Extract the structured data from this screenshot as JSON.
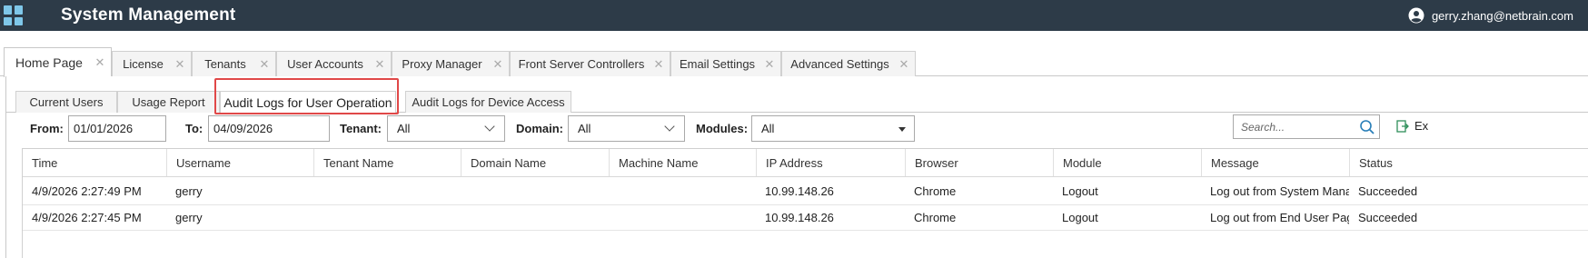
{
  "header": {
    "title": "System Management",
    "user": "gerry.zhang@netbrain.com",
    "colors": {
      "bar": "#2d3b48",
      "app_icon": "#7fc7e9"
    }
  },
  "top_tabs": [
    {
      "label": "Home Page",
      "active": true
    },
    {
      "label": "License"
    },
    {
      "label": "Tenants"
    },
    {
      "label": "User Accounts"
    },
    {
      "label": "Proxy Manager"
    },
    {
      "label": "Front Server Controllers"
    },
    {
      "label": "Email Settings"
    },
    {
      "label": "Advanced Settings"
    }
  ],
  "sub_tabs": [
    {
      "label": "Current Users"
    },
    {
      "label": "Usage Report"
    },
    {
      "label": "Audit Logs for User Operation",
      "active": true
    },
    {
      "label": "Audit Logs for Device Access"
    }
  ],
  "filters": {
    "from_label": "From:",
    "from_value": "01/01/2026",
    "to_label": "To:",
    "to_value": "04/09/2026",
    "tenant_label": "Tenant:",
    "tenant_value": "All",
    "domain_label": "Domain:",
    "domain_value": "All",
    "modules_label": "Modules:",
    "modules_value": "All",
    "search_placeholder": "Search...",
    "export_label": "Ex"
  },
  "table": {
    "columns": [
      "Time",
      "Username",
      "Tenant Name",
      "Domain Name",
      "Machine Name",
      "IP Address",
      "Browser",
      "Module",
      "Message",
      "Status"
    ],
    "rows": [
      [
        "4/9/2026 2:27:49 PM",
        "gerry",
        "",
        "",
        "",
        "10.99.148.26",
        "Chrome",
        "Logout",
        "Log out from System Manag...",
        "Succeeded"
      ],
      [
        "4/9/2026 2:27:45 PM",
        "gerry",
        "",
        "",
        "",
        "10.99.148.26",
        "Chrome",
        "Logout",
        "Log out from End User Page ...",
        "Succeeded"
      ]
    ]
  },
  "highlight_color": "#e04848"
}
